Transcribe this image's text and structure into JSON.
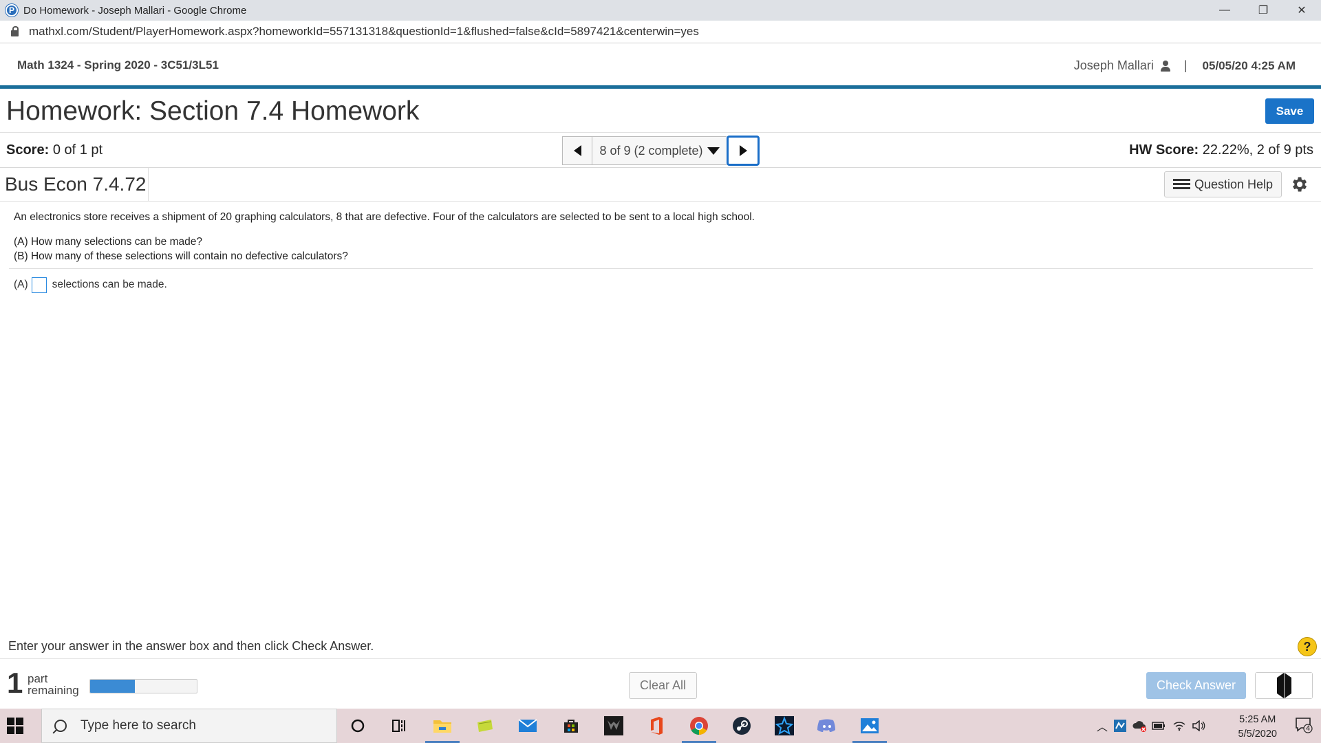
{
  "browser": {
    "window_title": "Do Homework - Joseph Mallari - Google Chrome",
    "url": "mathxl.com/Student/PlayerHomework.aspx?homeworkId=557131318&questionId=1&flushed=false&cId=5897421&centerwin=yes",
    "favicon_letter": "P",
    "controls": {
      "minimize": "—",
      "restore": "❐",
      "close": "✕"
    }
  },
  "course": {
    "title": "Math 1324 - Spring 2020 - 3C51/3L51",
    "user_name": "Joseph Mallari",
    "separator": "|",
    "datetime": "05/05/20 4:25 AM"
  },
  "homework": {
    "title": "Homework: Section 7.4 Homework",
    "save_label": "Save",
    "score_label": "Score:",
    "score_value": "0 of 1 pt",
    "question_selector": "8 of 9 (2 complete)",
    "hw_score_label": "HW Score:",
    "hw_score_value": "22.22%, 2 of 9 pts"
  },
  "problem": {
    "id": "Bus Econ 7.4.72",
    "question_help_label": "Question Help",
    "text": "An electronics store receives a shipment of 20 graphing calculators, 8 that are defective. Four of the calculators are selected to be sent to a local high school.",
    "part_a": "(A) How many selections can be made?",
    "part_b": "(B) How many of these selections will contain no defective calculators?",
    "answer_prefix": "(A)",
    "answer_suffix": "selections can be made.",
    "answer_value": ""
  },
  "footer": {
    "instruction": "Enter your answer in the answer box and then click Check Answer.",
    "help_glyph": "?",
    "parts_count": "1",
    "parts_label_1": "part",
    "parts_label_2": "remaining",
    "progress_fraction": 0.42,
    "clear_all_label": "Clear All",
    "check_answer_label": "Check Answer"
  },
  "taskbar": {
    "search_placeholder": "Type here to search",
    "time": "5:25 AM",
    "date": "5/5/2020",
    "notification_count": "4"
  },
  "colors": {
    "accent": "#1a73c8",
    "header_rule": "#1a6e9a",
    "progress": "#3b8bd4",
    "check_disabled": "#9fc3e6"
  }
}
